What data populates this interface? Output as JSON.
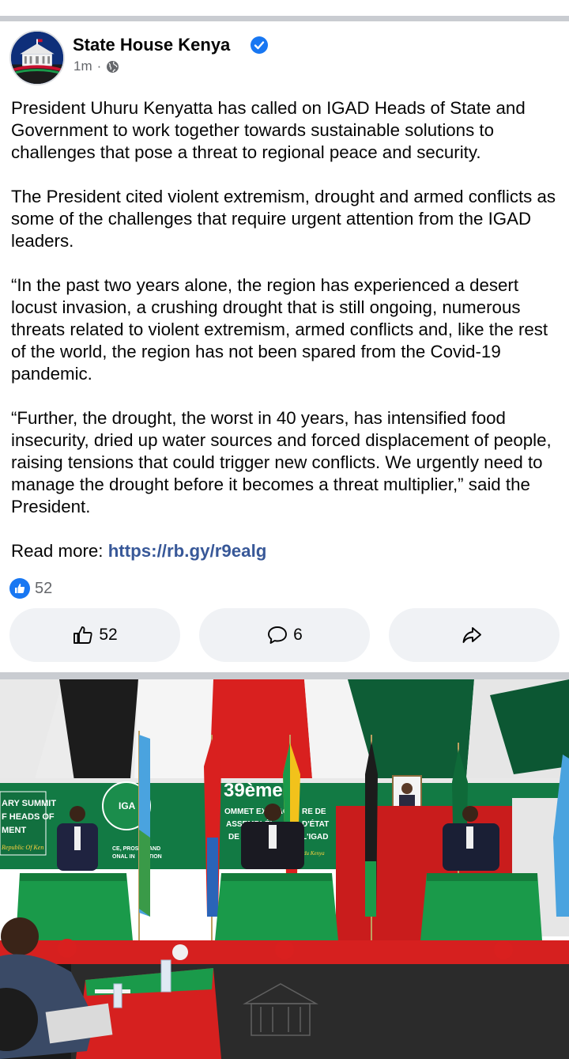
{
  "post": {
    "author": "State House Kenya",
    "time": "1m",
    "separator": "·",
    "paragraphs": [
      "President Uhuru Kenyatta has called on IGAD Heads of State and Government to work together towards sustainable solutions to challenges that pose a threat to regional peace and security.",
      "The President cited violent extremism, drought and armed conflicts as some of the challenges that require urgent attention  from the IGAD leaders.",
      "“In the past two years alone, the region has experienced a desert locust invasion, a crushing drought that is still ongoing, numerous threats related to violent extremism, armed conflicts and, like the rest of the world, the region has not been spared from the Covid-19 pandemic.",
      "“Further, the drought, the worst in 40 years, has intensified food insecurity, dried up water sources and forced displacement of people, raising tensions that could trigger new conflicts.  We urgently need to manage the drought before it becomes a threat multiplier,” said the President."
    ],
    "read_more_label": "Read more: ",
    "read_more_link": "https://rb.gy/r9ealg"
  },
  "reactions": {
    "count": "52"
  },
  "actions": {
    "like_count": "52",
    "comment_count": "6",
    "share_label": ""
  },
  "photo": {
    "banner_left": [
      "ARY SUMMIT",
      "F HEADS OF",
      "MENT",
      "Republic Of Ken"
    ],
    "banner_center": [
      "39ème",
      "OMMET EXTRAORI",
      "RE DE",
      "ASSEMBLÉI",
      "D'ÉTAT",
      "DE GO",
      "L'IGAD",
      "du Kenya"
    ],
    "banner_small": [
      "CE, PROS",
      "ONAL IN",
      "AND",
      "TION"
    ],
    "igad_logo": "IGA"
  },
  "colors": {
    "accent_blue": "#1877f2",
    "link": "#385898",
    "muted": "#65676b",
    "button_bg": "#f0f2f5",
    "table_green": "#1a9a4a",
    "carpet_red": "#d6201f"
  }
}
